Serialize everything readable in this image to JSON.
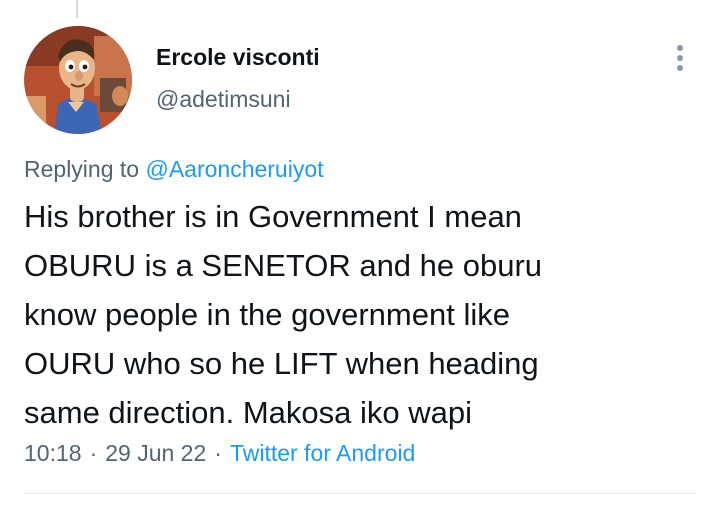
{
  "tweet": {
    "author": {
      "display_name": "Ercole visconti",
      "handle": "@adetimsuni",
      "avatar_icon": "cartoon-character-avatar"
    },
    "replying_to": {
      "label": "Replying to",
      "handle": "@Aaroncheruiyot"
    },
    "text_lines": [
      "His brother is in Government I mean",
      "OBURU is a SENETOR and he oburu",
      "know people in the government like",
      "OURU who so he LIFT when heading",
      "same direction. Makosa iko wapi"
    ],
    "time": "10:18",
    "date": "29 Jun 22",
    "separator": "·",
    "source": "Twitter for Android",
    "more_icon": "more-vertical-icon"
  },
  "colors": {
    "text_primary": "#0f1419",
    "text_secondary": "#536471",
    "link": "#1d9bf0",
    "divider": "#e1e8ed"
  }
}
